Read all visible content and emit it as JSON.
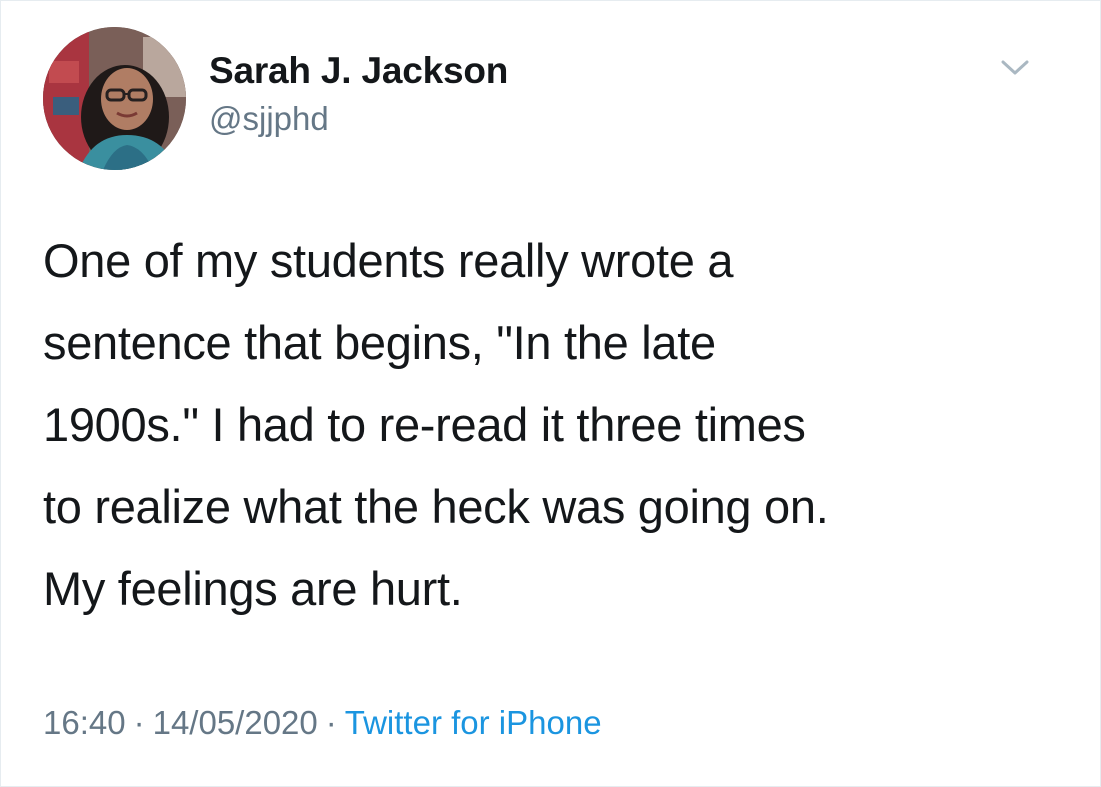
{
  "tweet": {
    "author": {
      "name": "Sarah J. Jackson",
      "handle": "@sjjphd"
    },
    "text_lines": [
      "One of my students really wrote a",
      "sentence that begins, \"In the late",
      "1900s.\" I had to re-read it three times",
      "to realize what the heck was going on.",
      "My feelings are hurt."
    ],
    "meta": {
      "time": "16:40",
      "separator": "·",
      "date": "14/05/2020",
      "source": "Twitter for iPhone"
    },
    "icons": {
      "menu": "chevron-down-icon",
      "avatar": "profile-photo"
    },
    "colors": {
      "text": "#14171a",
      "secondary": "#657786",
      "link": "#1b95e0",
      "border": "#e6ecf0"
    }
  }
}
